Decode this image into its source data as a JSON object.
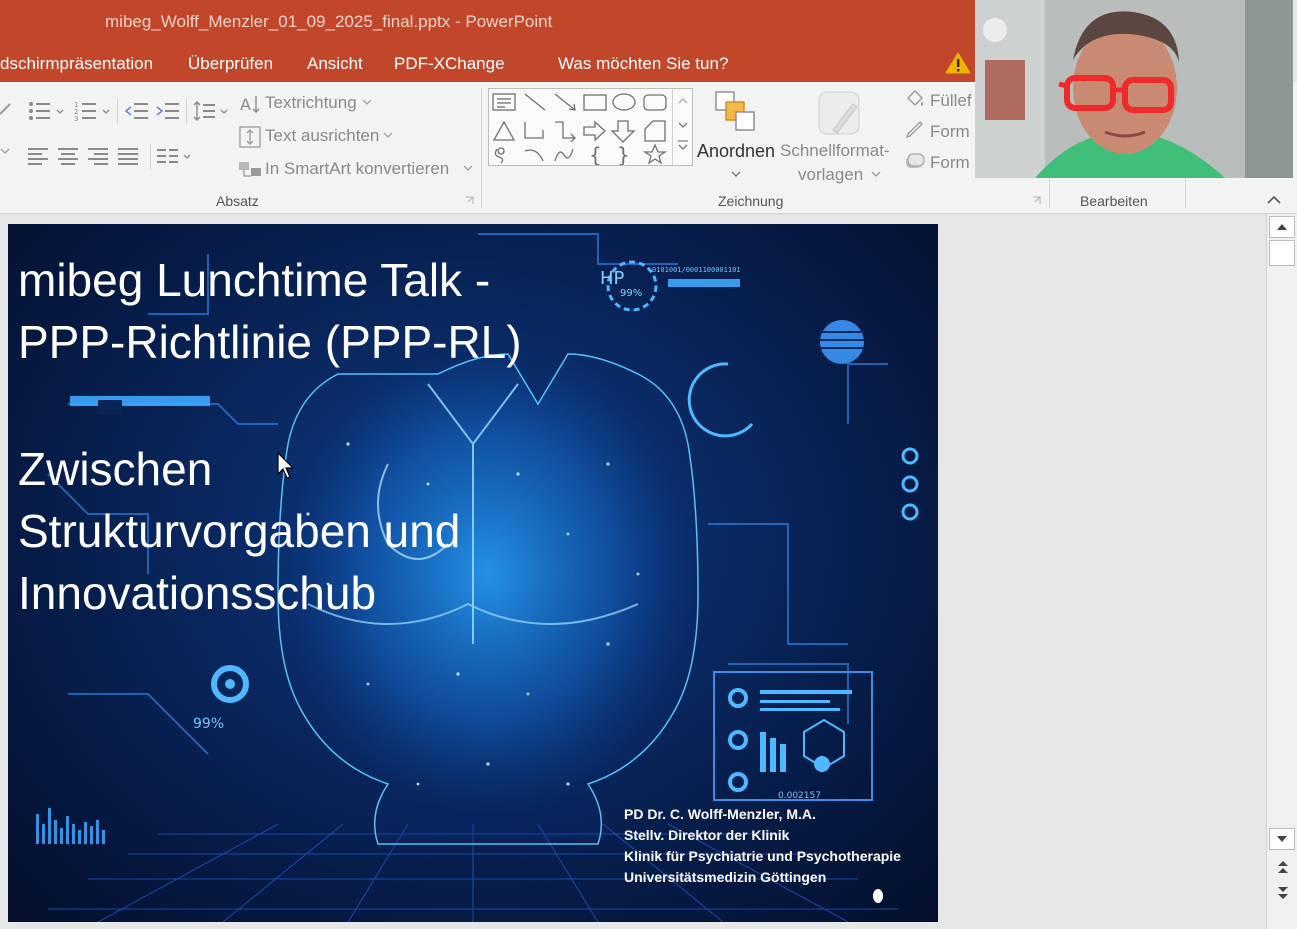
{
  "window": {
    "title": "mibeg_Wolff_Menzler_01_09_2025_final.pptx  -  PowerPoint"
  },
  "menu": {
    "tabs": [
      "dschirmpräsentation",
      "Überprüfen",
      "Ansicht",
      "PDF-XChange",
      "Was möchten Sie tun?"
    ]
  },
  "ribbon": {
    "paragraph": {
      "text_direction": "Textrichtung",
      "align_text": "Text ausrichten",
      "smartart": "In SmartArt konvertieren",
      "group_label": "Absatz"
    },
    "drawing": {
      "arrange": "Anordnen",
      "quick_styles_line1": "Schnellformat-",
      "quick_styles_line2": "vorlagen",
      "fill": "Füllef",
      "outline": "Form",
      "effects": "Form",
      "group_label": "Zeichnung"
    },
    "editing": {
      "group_label": "Bearbeiten"
    }
  },
  "slide": {
    "title_line1": "mibeg Lunchtime Talk -",
    "title_line2": "PPP-Richtlinie (PPP-RL)",
    "subtitle_line1": "Zwischen",
    "subtitle_line2": "Strukturvorgaben und",
    "subtitle_line3": "Innovationsschub",
    "author_line1": "PD Dr. C. Wolff-Menzler, M.A.",
    "author_line2": "Stellv. Direktor der Klinik",
    "author_line3": "Klinik für Psychiatrie und Psychotherapie",
    "author_line4": "Universitätsmedizin Göttingen",
    "decor_hp": "HP",
    "decor_pct1": "99%",
    "decor_pct2": "99%",
    "decor_num": "0.002157"
  },
  "colors": {
    "title_bar": "#c1462a",
    "ribbon_bg": "#f3f3f3",
    "slide_bg": "#0a2a64",
    "glow": "#3fb6ff"
  }
}
